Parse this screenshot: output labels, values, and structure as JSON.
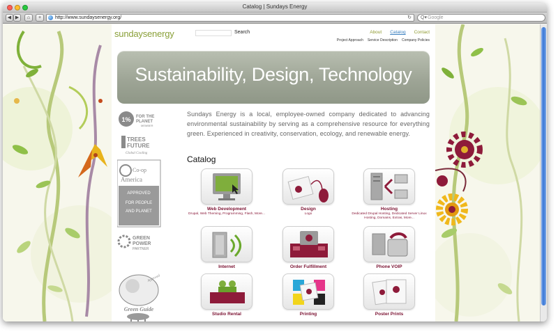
{
  "browser": {
    "title": "Catalog | Sundays Energy",
    "url": "http://www.sundaysenergy.org/",
    "search_placeholder": "Google"
  },
  "site": {
    "logo": "sundaysenergy",
    "search_label": "Search",
    "nav": [
      {
        "label": "About",
        "active": false
      },
      {
        "label": "Catalog",
        "active": true
      },
      {
        "label": "Contact",
        "active": false
      }
    ],
    "subnav": [
      "Project Approach",
      "Service Description",
      "Company Policies"
    ],
    "hero": "Sustainability, Design, Technology",
    "intro": "Sundays Energy is a local, employee-owned company dedicated to advancing environmental sustainability by serving as a comprehensive resource for everything green. Experienced in creativity, conservation, ecology, and renewable energy.",
    "catalog_heading": "Catalog"
  },
  "badges": [
    {
      "name": "1% for the planet",
      "text": "FOR THE PLANET",
      "sub": "MEMBER"
    },
    {
      "name": "trees for the future",
      "text": "TREES FUTURE",
      "sub": "Global Cooling"
    },
    {
      "name": "co-op america",
      "text": "Co-op America",
      "sub": "APPROVED FOR PEOPLE AND PLANET"
    },
    {
      "name": "epa green power partner",
      "text": "GREEN POWER",
      "sub": "PARTNER"
    },
    {
      "name": "green guide",
      "text": "Green Guide",
      "sub": "Approved"
    }
  ],
  "catalog": [
    {
      "label": "Web Development",
      "desc": "Drupal, Web Theming, Programming, Flash, More..."
    },
    {
      "label": "Design",
      "desc": "Logo"
    },
    {
      "label": "Hosting",
      "desc": "Dedicated Drupal Hosting, Dedicated Server Linux Hosting, Domains, Extras, More..."
    },
    {
      "label": "Internet",
      "desc": ""
    },
    {
      "label": "Order Fulfillment",
      "desc": ""
    },
    {
      "label": "Phone VOIP",
      "desc": ""
    },
    {
      "label": "Studio Rental",
      "desc": ""
    },
    {
      "label": "Printing",
      "desc": ""
    },
    {
      "label": "Poster Prints",
      "desc": ""
    }
  ],
  "colors": {
    "accent_green": "#8aa039",
    "catalog_label": "#7a1030",
    "nav_active": "#3a7fbf",
    "hero_bg": "#9ea596"
  }
}
